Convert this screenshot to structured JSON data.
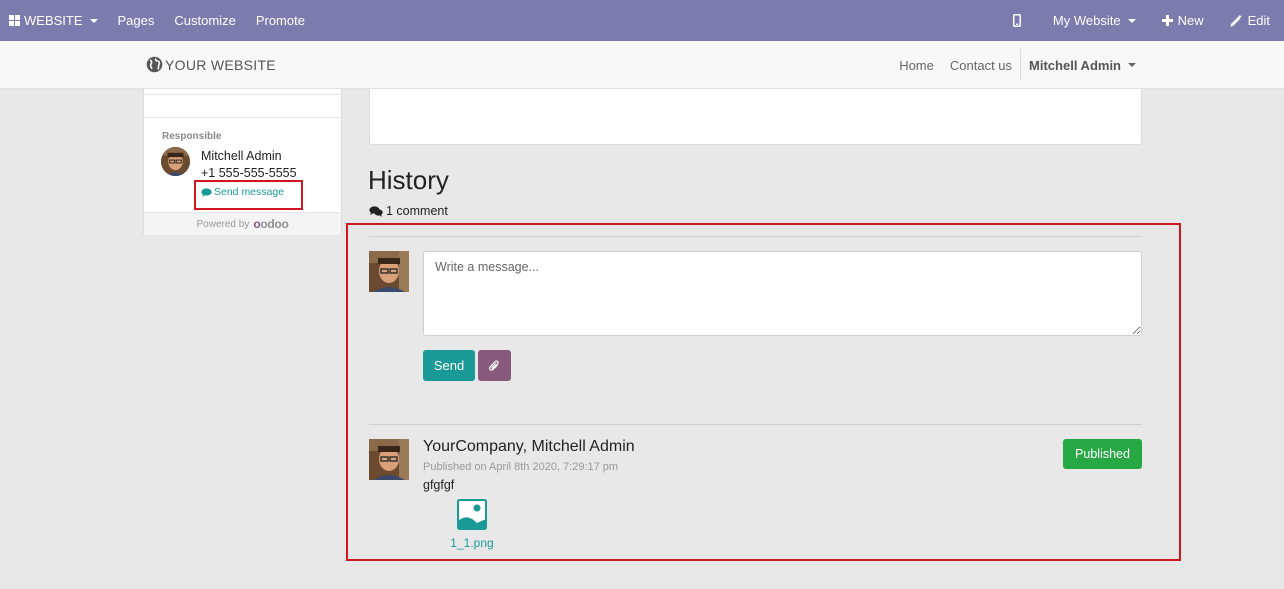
{
  "admin_bar": {
    "website_menu": "WEBSITE",
    "pages": "Pages",
    "customize": "Customize",
    "promote": "Promote",
    "my_website": "My Website",
    "new": "New",
    "edit": "Edit"
  },
  "navbar": {
    "logo_text": "YOUR WEBSITE",
    "links": [
      "Home",
      "Contact us"
    ],
    "user": "Mitchell Admin"
  },
  "sidebar": {
    "responsible_label": "Responsible",
    "name": "Mitchell Admin",
    "phone": "+1 555-555-5555",
    "send_message": "Send message",
    "powered_by": "Powered by",
    "powered_brand": "odoo"
  },
  "history": {
    "title": "History",
    "comment_count": "1 comment"
  },
  "composer": {
    "placeholder": "Write a message...",
    "send_label": "Send"
  },
  "message": {
    "author": "YourCompany, Mitchell Admin",
    "date": "Published on April 8th 2020, 7:29:17 pm",
    "body": "gfgfgf",
    "status": "Published",
    "attachment_name": "1_1.png"
  },
  "colors": {
    "admin_bar": "#7c7bad",
    "accent_teal": "#1a9a96",
    "attach_purple": "#875a7b",
    "published_green": "#28a745",
    "highlight_red": "#d0161e"
  }
}
